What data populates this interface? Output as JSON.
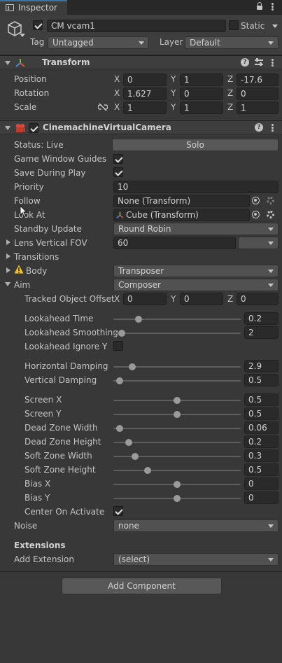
{
  "tab": {
    "label": "Inspector"
  },
  "gameobject": {
    "name": "CM vcam1",
    "static_label": "Static",
    "tag_label": "Tag",
    "tag_value": "Untagged",
    "layer_label": "Layer",
    "layer_value": "Default"
  },
  "transform": {
    "title": "Transform",
    "rows": [
      {
        "label": "Position",
        "x": "0",
        "y": "1",
        "z": "-17.6"
      },
      {
        "label": "Rotation",
        "x": "1.627",
        "y": "0",
        "z": "0"
      },
      {
        "label": "Scale",
        "x": "1",
        "y": "1",
        "z": "1"
      }
    ],
    "axis": {
      "x": "X",
      "y": "Y",
      "z": "Z"
    }
  },
  "vcam": {
    "title": "CinemachineVirtualCamera",
    "status_label": "Status: Live",
    "solo_label": "Solo",
    "game_window_guides": "Game Window Guides",
    "save_during_play": "Save During Play",
    "priority_label": "Priority",
    "priority_value": "10",
    "follow_label": "Follow",
    "follow_value": "None (Transform)",
    "lookat_label": "Look At",
    "lookat_value": "Cube (Transform)",
    "standby_label": "Standby Update",
    "standby_value": "Round Robin",
    "lens_label": "Lens Vertical FOV",
    "lens_value": "60",
    "transitions_label": "Transitions",
    "body_label": "Body",
    "body_value": "Transposer",
    "aim_label": "Aim",
    "aim_value": "Composer",
    "tracked_offset_label": "Tracked Object Offset",
    "tracked_offset": {
      "x": "0",
      "y": "0",
      "z": "0"
    },
    "lookahead_time_label": "Lookahead Time",
    "lookahead_smoothing_label": "Lookahead Smoothing",
    "lookahead_ignore_y_label": "Lookahead Ignore Y",
    "horizontal_damping_label": "Horizontal Damping",
    "vertical_damping_label": "Vertical Damping",
    "screen_x_label": "Screen X",
    "screen_y_label": "Screen Y",
    "dead_zone_width_label": "Dead Zone Width",
    "dead_zone_height_label": "Dead Zone Height",
    "soft_zone_width_label": "Soft Zone Width",
    "soft_zone_height_label": "Soft Zone Height",
    "bias_x_label": "Bias X",
    "bias_y_label": "Bias Y",
    "center_on_activate_label": "Center On Activate",
    "noise_label": "Noise",
    "noise_value": "none",
    "extensions_title": "Extensions",
    "add_extension_label": "Add Extension",
    "add_extension_value": "(select)"
  },
  "sliders": [
    {
      "key": "lookahead_time",
      "value": "0.2",
      "fraction": 0.2
    },
    {
      "key": "lookahead_smoothing",
      "value": "2",
      "fraction": 0.067
    },
    {
      "key": "horizontal_damping",
      "value": "2.9",
      "fraction": 0.15
    },
    {
      "key": "vertical_damping",
      "value": "0.5",
      "fraction": 0.05
    },
    {
      "key": "screen_x",
      "value": "0.5",
      "fraction": 0.5
    },
    {
      "key": "screen_y",
      "value": "0.5",
      "fraction": 0.5
    },
    {
      "key": "dead_zone_width",
      "value": "0.06",
      "fraction": 0.05
    },
    {
      "key": "dead_zone_height",
      "value": "0.2",
      "fraction": 0.12
    },
    {
      "key": "soft_zone_width",
      "value": "0.3",
      "fraction": 0.17
    },
    {
      "key": "soft_zone_height",
      "value": "0.5",
      "fraction": 0.27
    },
    {
      "key": "bias_x",
      "value": "0",
      "fraction": 0.5
    },
    {
      "key": "bias_y",
      "value": "0",
      "fraction": 0.5
    }
  ],
  "add_component_label": "Add Component"
}
